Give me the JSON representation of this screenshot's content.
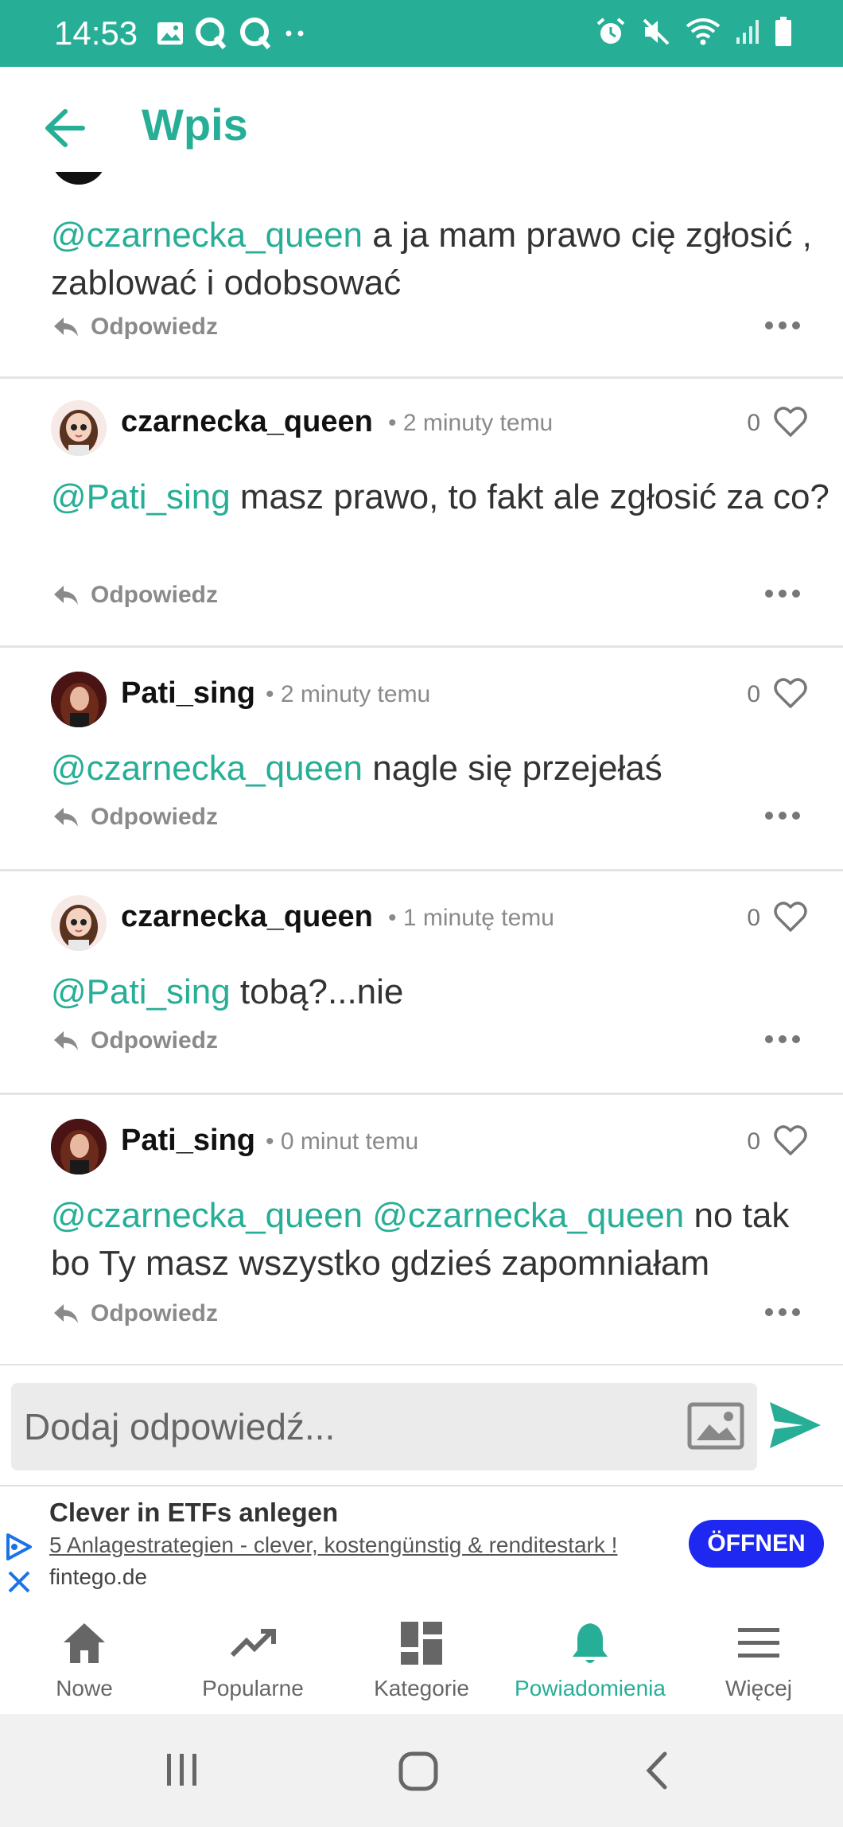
{
  "status_bar": {
    "time": "14:53"
  },
  "app_bar": {
    "title": "Wpis"
  },
  "colors": {
    "accent": "#27ae96",
    "ad_button": "#1e28f0"
  },
  "comments": [
    {
      "mention": "@czarnecka_queen",
      "text": " a ja mam prawo cię zgłosić , zablować i odobsować",
      "reply_label": "Odpowiedz"
    },
    {
      "user": "czarnecka_queen",
      "time": "• 2 minuty temu",
      "likes": "0",
      "mention": "@Pati_sing",
      "text": " masz prawo, to fakt ale zgłosić za co?",
      "reply_label": "Odpowiedz"
    },
    {
      "user": "Pati_sing",
      "time": "• 2 minuty temu",
      "likes": "0",
      "mention": "@czarnecka_queen",
      "text": " nagle się przejełaś",
      "reply_label": "Odpowiedz"
    },
    {
      "user": "czarnecka_queen",
      "time": "• 1 minutę temu",
      "likes": "0",
      "mention": "@Pati_sing",
      "text": " tobą?...nie",
      "reply_label": "Odpowiedz"
    },
    {
      "user": "Pati_sing",
      "time": "• 0 minut temu",
      "likes": "0",
      "mention": "@czarnecka_queen @czarnecka_queen",
      "text": " no tak bo Ty masz wszystko gdzieś zapomniałam",
      "reply_label": "Odpowiedz"
    }
  ],
  "reply_input": {
    "placeholder": "Dodaj odpowiedź..."
  },
  "ad": {
    "title": "Clever in ETFs anlegen",
    "description": "5 Anlagestrategien - clever, kostengünstig & renditestark !",
    "domain": "fintego.de",
    "button": "ÖFFNEN"
  },
  "bottom_nav": [
    {
      "label": "Nowe",
      "icon": "home-icon"
    },
    {
      "label": "Popularne",
      "icon": "trending-icon"
    },
    {
      "label": "Kategorie",
      "icon": "categories-icon"
    },
    {
      "label": "Powiadomienia",
      "icon": "bell-icon",
      "active": true
    },
    {
      "label": "Więcej",
      "icon": "menu-icon"
    }
  ]
}
